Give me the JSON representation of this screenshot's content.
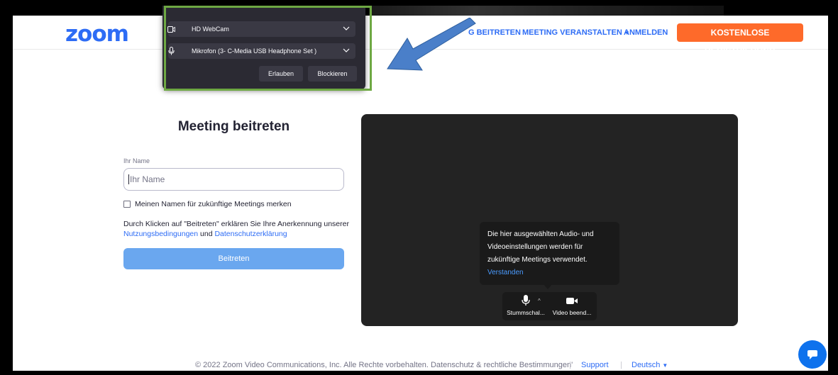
{
  "header": {
    "logo": "zoom",
    "nav_join": "G BEITRETEN",
    "nav_host": "MEETING VERANSTALTEN",
    "nav_signin": "ANMELDEN",
    "register": "KOSTENLOSE REGISTRIERUNG"
  },
  "form": {
    "title": "Meeting beitreten",
    "name_label": "Ihr Name",
    "name_placeholder": "Ihr Name",
    "name_value": "",
    "remember_checked": false,
    "remember_label": "Meinen Namen für zukünftige Meetings merken",
    "terms_prefix": "Durch Klicken auf \"Beitreten\" erklären Sie Ihre Anerkennung unserer ",
    "terms_link": "Nutzungsbedingungen",
    "terms_and": " und ",
    "privacy_link": "Datenschutzerklärung",
    "join_button": "Beitreten"
  },
  "preview": {
    "tooltip_text": "Die hier ausgewählten Audio- und Videoeinstellungen werden für zukünftige Meetings verwendet.",
    "tooltip_link": "Verstanden",
    "mic_label": "Stummschal...",
    "video_label": "Video beend..."
  },
  "footer": {
    "copyright": "© 2022 Zoom Video Communications, Inc. Alle Rechte vorbehalten. Datenschutz & rechtliche Bestimmungen'",
    "support": "Support",
    "language": "Deutsch"
  },
  "permission_popup": {
    "camera": "HD WebCam",
    "microphone": "Mikrofon (3- C-Media USB Headphone Set )",
    "allow": "Erlauben",
    "block": "Blockieren"
  },
  "colors": {
    "brand_blue": "#2d6cf5",
    "register_orange": "#fe6a2a",
    "join_button": "#6aa7ef",
    "highlight_green": "#6ea843",
    "arrow_blue": "#4a7fc9"
  }
}
